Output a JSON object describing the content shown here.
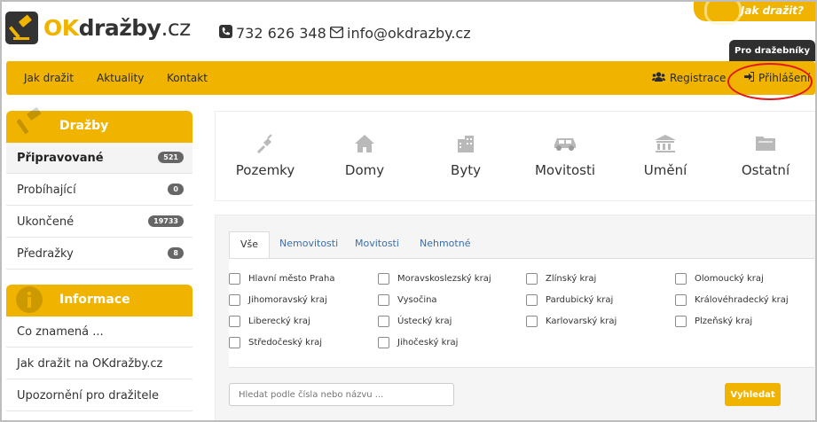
{
  "brand": {
    "ok": "OK",
    "drazby": "dražby",
    "tld": ".cz"
  },
  "contact": {
    "phone": "732 626 348",
    "email": "info@okdrazby.cz"
  },
  "help_tab": "Jak dražit?",
  "pro_tab": "Pro dražebníky",
  "nav": {
    "items": [
      "Jak dražit",
      "Aktuality",
      "Kontakt"
    ],
    "register": "Registrace",
    "login": "Přihlášení"
  },
  "sidebar": {
    "auctions_title": "Dražby",
    "auctions": [
      {
        "label": "Připravované",
        "count": "521"
      },
      {
        "label": "Probíhající",
        "count": "0"
      },
      {
        "label": "Ukončené",
        "count": "19733"
      },
      {
        "label": "Předražky",
        "count": "8"
      }
    ],
    "info_title": "Informace",
    "info": [
      "Co znamená ...",
      "Jak dražit na OKdražby.cz",
      "Upozornění pro dražitele"
    ]
  },
  "categories": [
    "Pozemky",
    "Domy",
    "Byty",
    "Movitosti",
    "Umění",
    "Ostatní"
  ],
  "filter": {
    "tabs": [
      "Vše",
      "Nemovitosti",
      "Movitosti",
      "Nehmotné"
    ],
    "regions": [
      [
        "Hlavní město Praha",
        "Moravskoslezský kraj",
        "Zlínský kraj",
        "Olomoucký kraj"
      ],
      [
        "Jihomoravský kraj",
        "Vysočina",
        "Pardubický kraj",
        "Královéhradecký kraj"
      ],
      [
        "Liberecký kraj",
        "Ústecký kraj",
        "Karlovarský kraj",
        "Plzeňský kraj"
      ],
      [
        "Středočeský kraj",
        "Jihočeský kraj"
      ]
    ],
    "search_placeholder": "Hledat podle čísla nebo názvu ...",
    "search_button": "Vyhledat"
  },
  "colors": {
    "accent": "#f0b400",
    "dark": "#333333",
    "link": "#3b6ea8",
    "highlight": "#e01a1a"
  }
}
